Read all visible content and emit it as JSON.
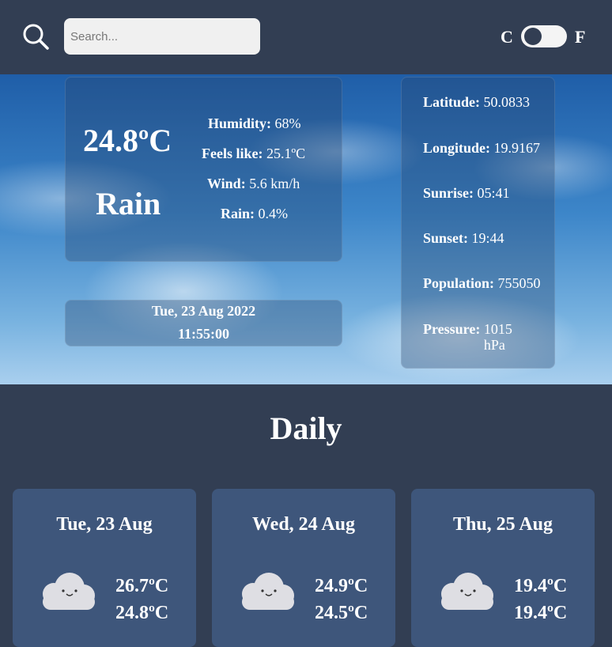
{
  "header": {
    "search_placeholder": "Search...",
    "unit_c": "C",
    "unit_f": "F"
  },
  "current": {
    "temp": "24.8ºC",
    "condition": "Rain",
    "stats": [
      {
        "label": "Humidity:",
        "value": "68%"
      },
      {
        "label": "Feels like:",
        "value": "25.1ºC"
      },
      {
        "label": "Wind:",
        "value": "5.6 km/h"
      },
      {
        "label": "Rain:",
        "value": "0.4%"
      }
    ],
    "date": "Tue, 23 Aug 2022",
    "time": "11:55:00"
  },
  "info": {
    "latitude": {
      "label": "Latitude:",
      "value": "50.0833"
    },
    "longitude": {
      "label": "Longitude:",
      "value": "19.9167"
    },
    "sunrise": {
      "label": "Sunrise:",
      "value": "05:41"
    },
    "sunset": {
      "label": "Sunset:",
      "value": "19:44"
    },
    "population": {
      "label": "Population:",
      "value": "755050"
    },
    "pressure": {
      "label": "Pressure:",
      "value": "1015",
      "unit": "hPa"
    }
  },
  "daily": {
    "title": "Daily",
    "days": [
      {
        "name": "Tue, 23 Aug",
        "high": "26.7ºC",
        "low": "24.8ºC",
        "icon": "cloud-icon"
      },
      {
        "name": "Wed, 24 Aug",
        "high": "24.9ºC",
        "low": "24.5ºC",
        "icon": "cloud-icon"
      },
      {
        "name": "Thu, 25 Aug",
        "high": "19.4ºC",
        "low": "19.4ºC",
        "icon": "cloud-icon"
      }
    ]
  },
  "colors": {
    "background": "#323e53",
    "card": "#3e567b"
  }
}
